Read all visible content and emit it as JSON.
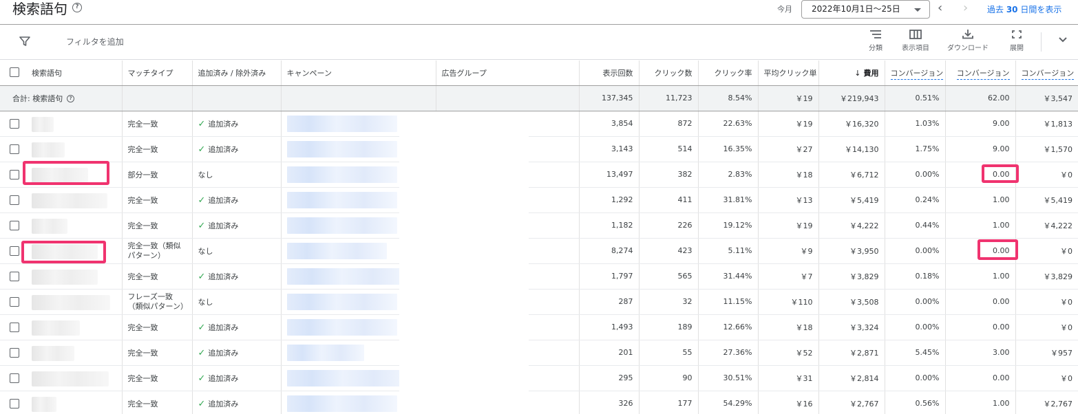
{
  "header": {
    "title": "検索語句",
    "date_label": "今月",
    "date_range": "2022年10月1日〜25日",
    "past_prefix": "過去 ",
    "past_days": "30",
    "past_suffix": " 日間を表示"
  },
  "toolbar": {
    "filter_add": "フィルタを追加",
    "segment": "分類",
    "columns": "表示項目",
    "download": "ダウンロード",
    "expand": "展開"
  },
  "columns": {
    "search_term": "検索語句",
    "match_type": "マッチタイプ",
    "added_excluded": "追加済み / 除外済み",
    "campaign": "キャンペーン",
    "ad_group": "広告グループ",
    "impressions": "表示回数",
    "clicks": "クリック数",
    "ctr": "クリック率",
    "avg_cpc": "平均クリック単",
    "cost": "費用",
    "conv_rate": "コンバージョン",
    "conversions": "コンバージョン",
    "cost_per_conv": "コンバージョン"
  },
  "total": {
    "label": "合計: 検索語句",
    "impressions": "137,345",
    "clicks": "11,723",
    "ctr": "8.54%",
    "avg_cpc": "￥19",
    "cost": "￥219,943",
    "conv_rate": "0.51%",
    "conversions": "62.00",
    "cost_per_conv": "￥3,547"
  },
  "rows": [
    {
      "match": "完全一致",
      "added": "追加済み",
      "imp": "3,854",
      "clicks": "872",
      "ctr": "22.63%",
      "cpc": "￥19",
      "cost": "￥16,320",
      "cvr": "1.03%",
      "conv": "9.00",
      "cpa": "￥1,813"
    },
    {
      "match": "完全一致",
      "added": "追加済み",
      "imp": "3,143",
      "clicks": "514",
      "ctr": "16.35%",
      "cpc": "￥27",
      "cost": "￥14,130",
      "cvr": "1.75%",
      "conv": "9.00",
      "cpa": "￥1,570"
    },
    {
      "match": "部分一致",
      "added": "なし",
      "imp": "13,497",
      "clicks": "382",
      "ctr": "2.83%",
      "cpc": "￥18",
      "cost": "￥6,712",
      "cvr": "0.00%",
      "conv": "0.00",
      "cpa": "￥0"
    },
    {
      "match": "完全一致",
      "added": "追加済み",
      "imp": "1,292",
      "clicks": "411",
      "ctr": "31.81%",
      "cpc": "￥13",
      "cost": "￥5,419",
      "cvr": "0.24%",
      "conv": "1.00",
      "cpa": "￥5,419"
    },
    {
      "match": "完全一致",
      "added": "追加済み",
      "imp": "1,182",
      "clicks": "226",
      "ctr": "19.12%",
      "cpc": "￥19",
      "cost": "￥4,222",
      "cvr": "0.44%",
      "conv": "1.00",
      "cpa": "￥4,222"
    },
    {
      "match": "完全一致（類似パターン）",
      "added": "なし",
      "imp": "8,274",
      "clicks": "423",
      "ctr": "5.11%",
      "cpc": "￥9",
      "cost": "￥3,950",
      "cvr": "0.00%",
      "conv": "0.00",
      "cpa": "￥0"
    },
    {
      "match": "完全一致",
      "added": "追加済み",
      "imp": "1,797",
      "clicks": "565",
      "ctr": "31.44%",
      "cpc": "￥7",
      "cost": "￥3,829",
      "cvr": "0.18%",
      "conv": "1.00",
      "cpa": "￥3,829"
    },
    {
      "match": "フレーズ一致（類似パターン）",
      "added": "なし",
      "imp": "287",
      "clicks": "32",
      "ctr": "11.15%",
      "cpc": "￥110",
      "cost": "￥3,508",
      "cvr": "0.00%",
      "conv": "0.00",
      "cpa": "￥0"
    },
    {
      "match": "完全一致",
      "added": "追加済み",
      "imp": "1,493",
      "clicks": "189",
      "ctr": "12.66%",
      "cpc": "￥18",
      "cost": "￥3,324",
      "cvr": "0.00%",
      "conv": "0.00",
      "cpa": "￥0"
    },
    {
      "match": "完全一致",
      "added": "追加済み",
      "imp": "201",
      "clicks": "55",
      "ctr": "27.36%",
      "cpc": "￥52",
      "cost": "￥2,871",
      "cvr": "5.45%",
      "conv": "3.00",
      "cpa": "￥957"
    },
    {
      "match": "完全一致",
      "added": "追加済み",
      "imp": "295",
      "clicks": "90",
      "ctr": "30.51%",
      "cpc": "￥31",
      "cost": "￥2,814",
      "cvr": "0.00%",
      "conv": "0.00",
      "cpa": "￥0"
    },
    {
      "match": "完全一致",
      "added": "追加済み",
      "imp": "326",
      "clicks": "177",
      "ctr": "54.29%",
      "cpc": "￥16",
      "cost": "￥2,767",
      "cvr": "0.56%",
      "conv": "1.00",
      "cpa": "￥2,767"
    }
  ],
  "colors": {
    "accent": "#1a73e8",
    "highlight": "#f0336f",
    "check": "#34a853"
  },
  "icons": {
    "help": "help-circle-icon",
    "filter": "filter-icon",
    "check": "check-icon",
    "sort": "arrow-down-icon"
  }
}
